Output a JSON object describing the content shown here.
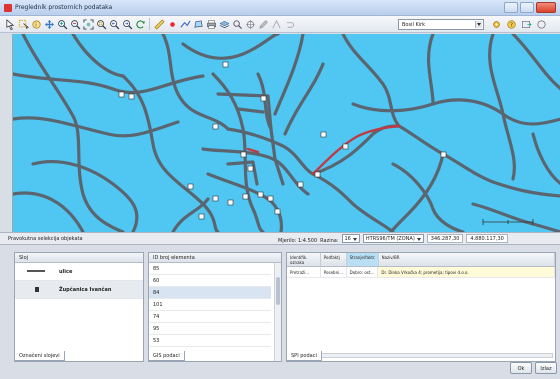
{
  "window": {
    "title": "Pregledník prostorních podataka"
  },
  "toolbar": {
    "scale_combo": "Bosil Kirk"
  },
  "status": {
    "selection_label": "Pravokutna selekcija objekata",
    "scale_label": "Mjerilo: 1:4.500",
    "layer_label": "Razina:",
    "level_value": "16",
    "crs_value": "HTRS96/TM (ZONA)",
    "coord_x": "346.287,30",
    "coord_y": "4.880.117,30"
  },
  "layers": {
    "header": "Sloj",
    "items": [
      {
        "name": "ulice",
        "color": "#555555"
      },
      {
        "name": "Župčanica Ivančan",
        "color": "#333333"
      }
    ],
    "tab": "Označeni slojevi"
  },
  "ids": {
    "header": "ID broj elementa",
    "rows": [
      "85",
      "60",
      "84",
      "101",
      "74",
      "95",
      "53"
    ],
    "selected_index": 2,
    "tab": "GIS podaci"
  },
  "attributes": {
    "columns": [
      "Identifik. oznaka",
      "Podfaktj",
      "Stranje/faktr.",
      "Naziv/BR"
    ],
    "rows": [
      [
        "Pretraži...",
        "Posebni...",
        "Dobro: ost...",
        "Dr. Dinka Vrkoćka 4; prometija; tipovi d.o.o."
      ]
    ],
    "tab": "SPI podaci"
  },
  "buttons": {
    "ok": "Ok",
    "close": "Izlaz"
  },
  "colors": {
    "map_water": "#4fc7f2",
    "road": "#5b6570",
    "highlight_road": "#c03a44"
  }
}
